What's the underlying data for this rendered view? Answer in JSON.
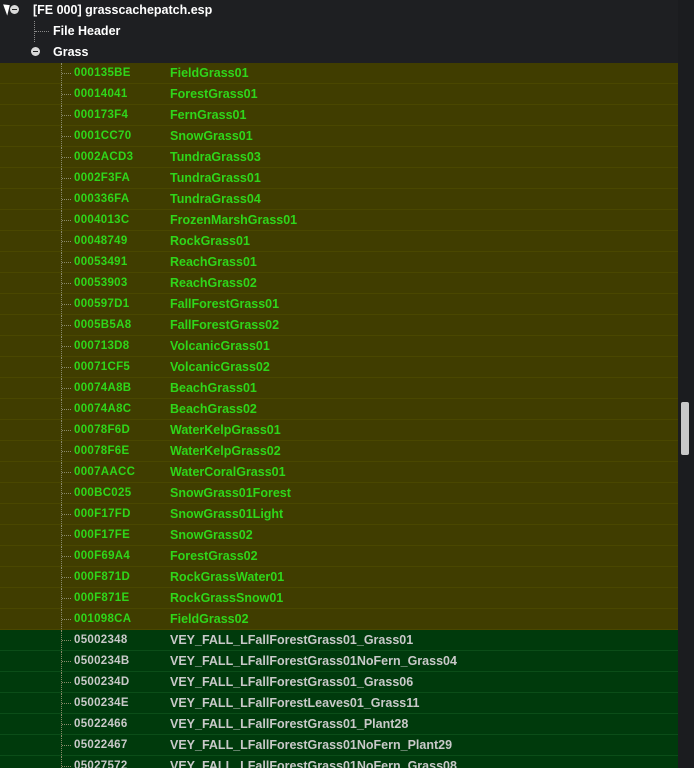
{
  "tree": {
    "root_label": "[FE 000] grasscachepatch.esp",
    "file_header_label": "File Header",
    "group_label": "Grass",
    "yellow_rows": [
      {
        "id": "000135BE",
        "name": "FieldGrass01"
      },
      {
        "id": "00014041",
        "name": "ForestGrass01"
      },
      {
        "id": "000173F4",
        "name": "FernGrass01"
      },
      {
        "id": "0001CC70",
        "name": "SnowGrass01"
      },
      {
        "id": "0002ACD3",
        "name": "TundraGrass03"
      },
      {
        "id": "0002F3FA",
        "name": "TundraGrass01"
      },
      {
        "id": "000336FA",
        "name": "TundraGrass04"
      },
      {
        "id": "0004013C",
        "name": "FrozenMarshGrass01"
      },
      {
        "id": "00048749",
        "name": "RockGrass01"
      },
      {
        "id": "00053491",
        "name": "ReachGrass01"
      },
      {
        "id": "00053903",
        "name": "ReachGrass02"
      },
      {
        "id": "000597D1",
        "name": "FallForestGrass01"
      },
      {
        "id": "0005B5A8",
        "name": "FallForestGrass02"
      },
      {
        "id": "000713D8",
        "name": "VolcanicGrass01"
      },
      {
        "id": "00071CF5",
        "name": "VolcanicGrass02"
      },
      {
        "id": "00074A8B",
        "name": "BeachGrass01"
      },
      {
        "id": "00074A8C",
        "name": "BeachGrass02"
      },
      {
        "id": "00078F6D",
        "name": "WaterKelpGrass01"
      },
      {
        "id": "00078F6E",
        "name": "WaterKelpGrass02"
      },
      {
        "id": "0007AACC",
        "name": "WaterCoralGrass01"
      },
      {
        "id": "000BC025",
        "name": "SnowGrass01Forest"
      },
      {
        "id": "000F17FD",
        "name": "SnowGrass01Light"
      },
      {
        "id": "000F17FE",
        "name": "SnowGrass02"
      },
      {
        "id": "000F69A4",
        "name": "ForestGrass02"
      },
      {
        "id": "000F871D",
        "name": "RockGrassWater01"
      },
      {
        "id": "000F871E",
        "name": "RockGrassSnow01"
      },
      {
        "id": "001098CA",
        "name": "FieldGrass02"
      }
    ],
    "green_rows": [
      {
        "id": "05002348",
        "name": "VEY_FALL_LFallForestGrass01_Grass01"
      },
      {
        "id": "0500234B",
        "name": "VEY_FALL_LFallForestGrass01NoFern_Grass04"
      },
      {
        "id": "0500234D",
        "name": "VEY_FALL_LFallForestGrass01_Grass06"
      },
      {
        "id": "0500234E",
        "name": "VEY_FALL_LFallForestLeaves01_Grass11"
      },
      {
        "id": "05022466",
        "name": "VEY_FALL_LFallForestGrass01_Plant28"
      },
      {
        "id": "05022467",
        "name": "VEY_FALL_LFallForestGrass01NoFern_Plant29"
      },
      {
        "id": "05027572",
        "name": "VEY_FALL_LFallForestGrass01NoFern_Grass08"
      }
    ]
  },
  "colors": {
    "background": "#1e1f22",
    "yellow_row_bg": "#403d00",
    "green_row_bg": "#003a0c",
    "active_text": "#2fd61a",
    "override_text": "#c9c9c9"
  }
}
